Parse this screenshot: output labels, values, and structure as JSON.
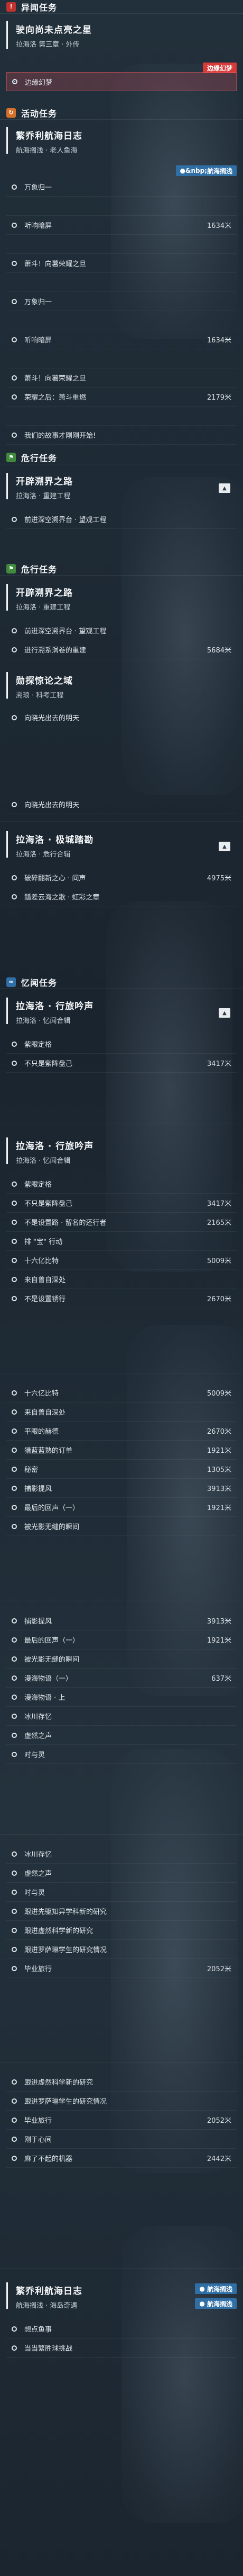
{
  "colors": {
    "accent_red": "#c0322f",
    "accent_orange": "#d5702a",
    "accent_green": "#3f8a3d",
    "accent_blue": "#2f6fa6",
    "tag_red": "#d83a3a"
  },
  "icons": {
    "anomaly": "warning-icon",
    "event": "refresh-icon",
    "danger": "flag-icon",
    "trace": "chain-icon",
    "pin": "pin-icon",
    "radio": "radio-icon"
  },
  "panel1": {
    "header": "异闻任务",
    "quest_title": "驶向尚未点亮之星",
    "quest_sub": "拉海洛 第三章 · 外传",
    "tag": "边缘幻梦",
    "objective": "边缘幻梦"
  },
  "panel2": {
    "header": "活动任务",
    "quest_title": "繁乔利航海日志",
    "quest_sub": "航海搁浅 · 老人鱼海",
    "tag": "航海搁浅",
    "rows": [
      {
        "text": "万象归一",
        "dist": ""
      },
      {
        "text": "",
        "dist": ""
      },
      {
        "text": "听响暗屏",
        "dist": "1634米"
      },
      {
        "text": "",
        "dist": ""
      },
      {
        "text": "萧斗！向薯荣耀之旦",
        "dist": ""
      },
      {
        "text": "",
        "dist": ""
      },
      {
        "text": "万象归一",
        "dist": ""
      },
      {
        "text": "",
        "dist": ""
      },
      {
        "text": "听响暗屏",
        "dist": "1634米"
      },
      {
        "text": "",
        "dist": ""
      },
      {
        "text": "萧斗！向薯荣耀之旦",
        "dist": ""
      },
      {
        "text": "荣耀之后：萧斗重燃",
        "dist": "2179米"
      },
      {
        "text": "",
        "dist": ""
      },
      {
        "text": "我们的故事才刚刚开始!",
        "dist": ""
      }
    ]
  },
  "panel3": {
    "header": "危行任务",
    "quest_title": "开辟溯界之路",
    "quest_sub": "拉海洛 · 重建工程",
    "rows": [
      {
        "text": "前进深空溯界台 · 望观工程",
        "dist": ""
      }
    ]
  },
  "panel4": {
    "header": "危行任务",
    "quest_title": "开辟溯界之路",
    "quest_sub": "拉海洛 · 重建工程",
    "rows": [
      {
        "text": "前进深空溯界台 · 望观工程",
        "dist": ""
      },
      {
        "text": "进行溯系涡卷的重建",
        "dist": "5684米"
      }
    ],
    "quest2_title": "勋探惊论之域",
    "quest2_sub": "溯琅 · 科考工程",
    "rows2": [
      {
        "text": "向晓光出去的明天",
        "dist": ""
      }
    ]
  },
  "panel5": {
    "quest_title": "拉海洛 · 极城踏勘",
    "quest_sub": "拉海洛 · 危行合辑",
    "rows_top": [
      {
        "text": "向晓光出去的明天",
        "dist": ""
      }
    ],
    "rows": [
      {
        "text": "破碎翻新之心 · 间声",
        "dist": "4975米"
      },
      {
        "text": "瓢差云海之歌 · 虹彩之章",
        "dist": ""
      }
    ]
  },
  "panel6": {
    "header": "忆闻任务",
    "quest_title": "拉海洛 · 行旅吟声",
    "quest_sub": "拉海洛 · 忆闻合辑",
    "rows": [
      {
        "text": "紫眼定格",
        "dist": ""
      },
      {
        "text": "不只是紫阵盘己",
        "dist": "3417米"
      }
    ]
  },
  "panel7": {
    "quest_title": "拉海洛 · 行旅吟声",
    "quest_sub": "拉海洛 · 忆闻合辑",
    "rows": [
      {
        "text": "紫眼定格",
        "dist": ""
      },
      {
        "text": "不只是紫阵盘己",
        "dist": "3417米"
      },
      {
        "text": "不是设置路 · 留名的还行者",
        "dist": "2165米"
      },
      {
        "text": "排 \"宝\" 行动",
        "dist": ""
      },
      {
        "text": "十六亿比特",
        "dist": "5009米"
      },
      {
        "text": "来自曾自深处",
        "dist": ""
      },
      {
        "text": "不是设置锈行",
        "dist": "2670米"
      }
    ]
  },
  "panel8": {
    "rows": [
      {
        "text": "十六亿比特",
        "dist": "5009米"
      },
      {
        "text": "来自曾自深处",
        "dist": ""
      },
      {
        "text": "平眼的赫德",
        "dist": "2670米"
      },
      {
        "text": "猎蓝蓝熟的订单",
        "dist": "1921米"
      },
      {
        "text": "秘密",
        "dist": "1305米"
      },
      {
        "text": "捕影提风",
        "dist": "3913米"
      },
      {
        "text": "最后的回声（一）",
        "dist": "1921米"
      },
      {
        "text": "被光影无缝的瞬间",
        "dist": ""
      }
    ]
  },
  "panel9": {
    "rows": [
      {
        "text": "捕影提风",
        "dist": "3913米"
      },
      {
        "text": "最后的回声（一）",
        "dist": "1921米"
      },
      {
        "text": "被光影无缝的瞬间",
        "dist": ""
      },
      {
        "text": "漫海物语（一）",
        "dist": "637米"
      },
      {
        "text": "漫海物语 · 上",
        "dist": ""
      },
      {
        "text": "冰川存忆",
        "dist": ""
      },
      {
        "text": "虚然之声",
        "dist": ""
      },
      {
        "text": "时与灵",
        "dist": ""
      }
    ]
  },
  "panel10": {
    "rows": [
      {
        "text": "冰川存忆",
        "dist": ""
      },
      {
        "text": "虚然之声",
        "dist": ""
      },
      {
        "text": "时与灵",
        "dist": ""
      },
      {
        "text": "跟进先驱知异学科新的研究",
        "dist": ""
      },
      {
        "text": "跟进虚然科学新的研究",
        "dist": ""
      },
      {
        "text": "跟进罗萨琳学生的研究情况",
        "dist": ""
      },
      {
        "text": "毕业旅行",
        "dist": "2052米"
      }
    ]
  },
  "panel11": {
    "rows": [
      {
        "text": "跟进虚然科学新的研究",
        "dist": ""
      },
      {
        "text": "跟进罗萨琳学生的研究情况",
        "dist": ""
      },
      {
        "text": "毕业旅行",
        "dist": "2052米"
      },
      {
        "text": "刚于心间",
        "dist": ""
      },
      {
        "text": "麻了不起的机器",
        "dist": "2442米"
      }
    ]
  },
  "panel12": {
    "quest_title": "繁乔利航海日志",
    "quest_sub": "航海搁浅 · 海岛奇遇",
    "tag": "航海搁浅",
    "rows": [
      {
        "text": "想点鱼事",
        "dist": ""
      },
      {
        "text": "当当繁胜球挑战",
        "dist": ""
      }
    ]
  }
}
